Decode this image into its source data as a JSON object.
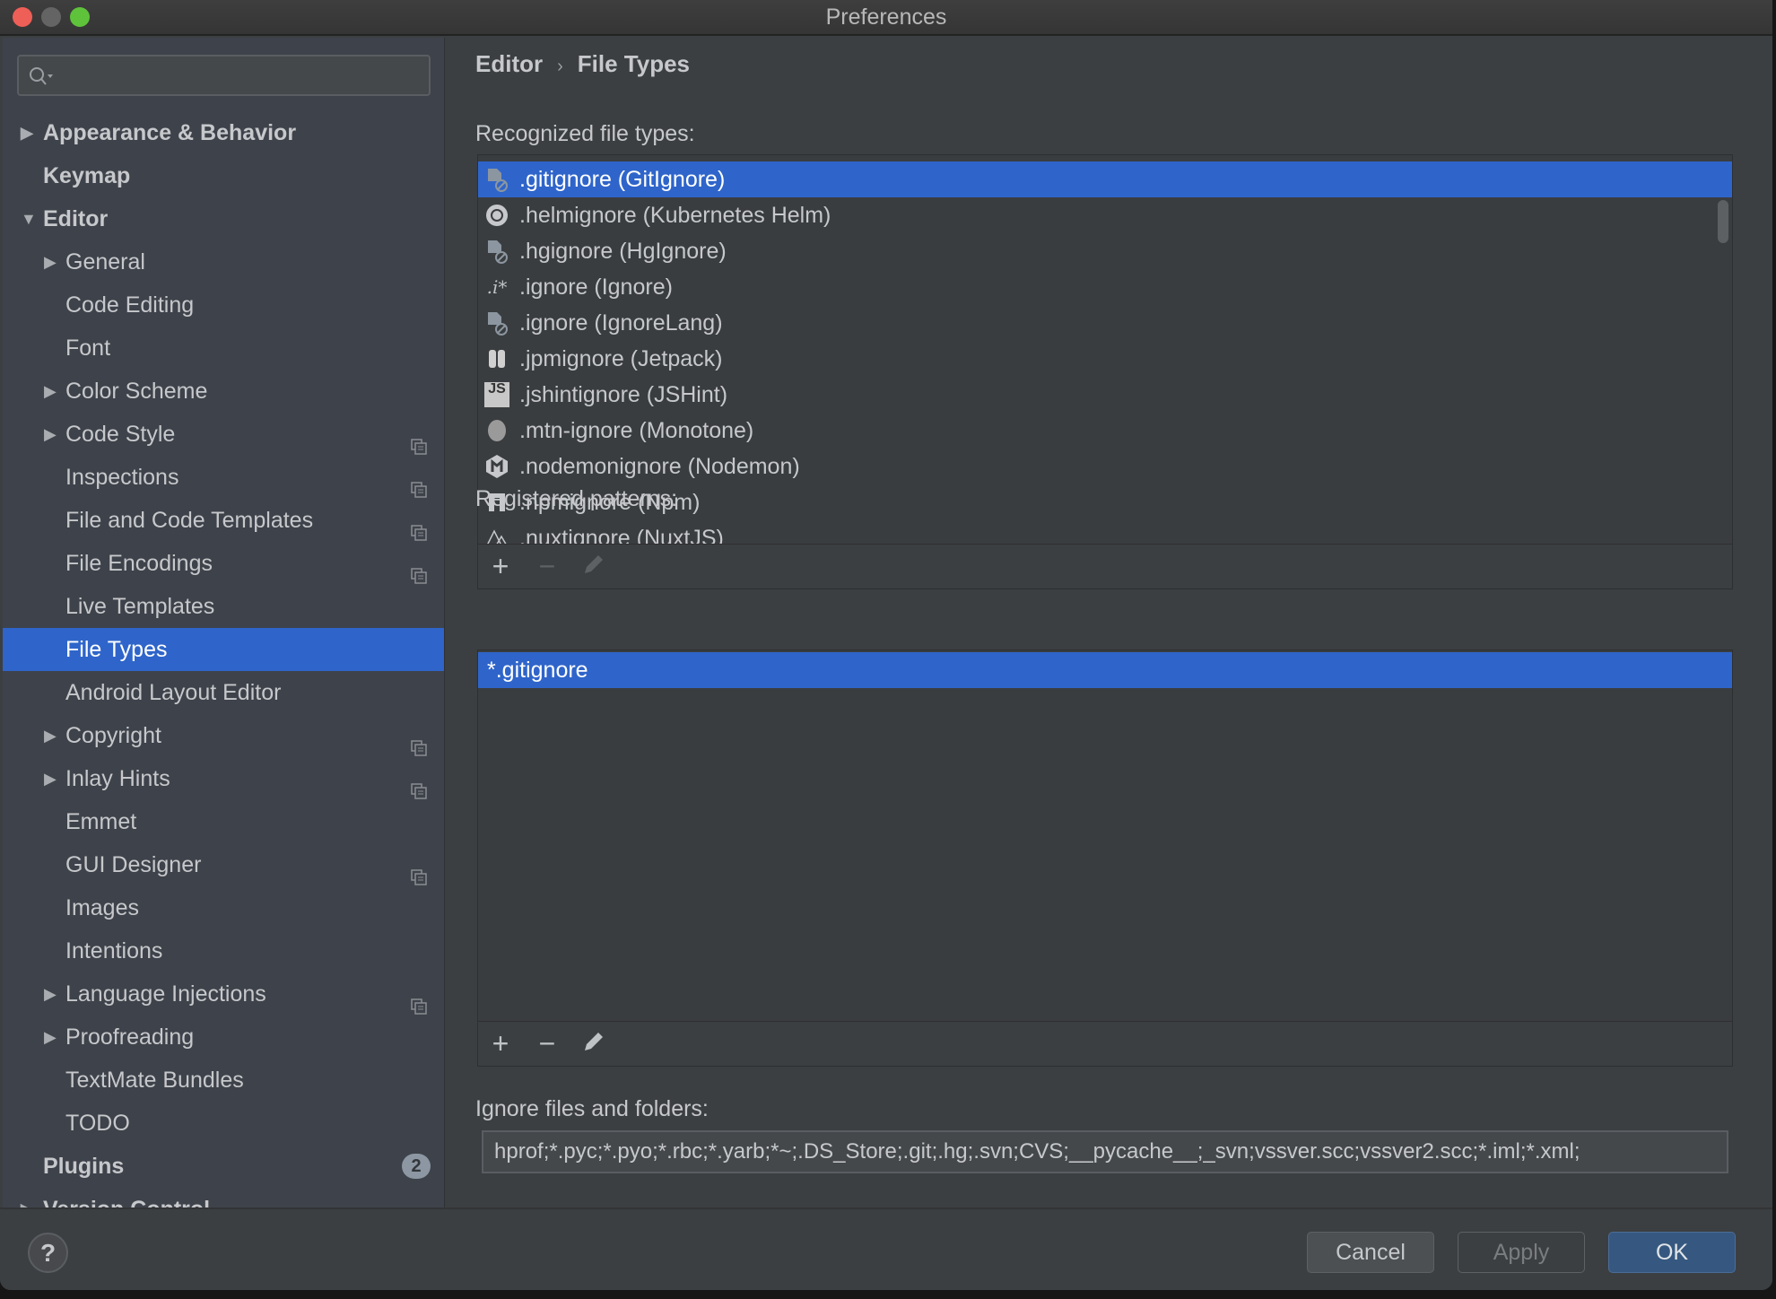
{
  "window": {
    "title": "Preferences",
    "traffic_lights": {
      "close": "#ee5f57",
      "minimize": "#646464",
      "zoom": "#5fc23b"
    }
  },
  "search": {
    "placeholder": "",
    "value": ""
  },
  "sidebar": {
    "items": [
      {
        "label": "Appearance & Behavior",
        "level": 0,
        "arrow": "right",
        "bold": true
      },
      {
        "label": "Keymap",
        "level": 0,
        "bold": true
      },
      {
        "label": "Editor",
        "level": 0,
        "arrow": "down",
        "bold": true
      },
      {
        "label": "General",
        "level": 1,
        "arrow": "right"
      },
      {
        "label": "Code Editing",
        "level": 1
      },
      {
        "label": "Font",
        "level": 1
      },
      {
        "label": "Color Scheme",
        "level": 1,
        "arrow": "right"
      },
      {
        "label": "Code Style",
        "level": 1,
        "arrow": "right",
        "project_icon": true
      },
      {
        "label": "Inspections",
        "level": 1,
        "project_icon": true
      },
      {
        "label": "File and Code Templates",
        "level": 1,
        "project_icon": true
      },
      {
        "label": "File Encodings",
        "level": 1,
        "project_icon": true
      },
      {
        "label": "Live Templates",
        "level": 1
      },
      {
        "label": "File Types",
        "level": 1,
        "selected": true
      },
      {
        "label": "Android Layout Editor",
        "level": 1
      },
      {
        "label": "Copyright",
        "level": 1,
        "arrow": "right",
        "project_icon": true
      },
      {
        "label": "Inlay Hints",
        "level": 1,
        "arrow": "right",
        "project_icon": true
      },
      {
        "label": "Emmet",
        "level": 1
      },
      {
        "label": "GUI Designer",
        "level": 1,
        "project_icon": true
      },
      {
        "label": "Images",
        "level": 1
      },
      {
        "label": "Intentions",
        "level": 1
      },
      {
        "label": "Language Injections",
        "level": 1,
        "arrow": "right",
        "project_icon": true
      },
      {
        "label": "Proofreading",
        "level": 1,
        "arrow": "right"
      },
      {
        "label": "TextMate Bundles",
        "level": 1
      },
      {
        "label": "TODO",
        "level": 1
      },
      {
        "label": "Plugins",
        "level": 0,
        "bold": true,
        "badge": "2"
      },
      {
        "label": "Version Control",
        "level": 0,
        "arrow": "right",
        "bold": true,
        "project_icon": true
      }
    ]
  },
  "breadcrumb": {
    "parent": "Editor",
    "separator": "›",
    "current": "File Types"
  },
  "recognized": {
    "label": "Recognized file types:",
    "items": [
      {
        "label": ".gitignore (GitIgnore)",
        "icon": "ignore-file-icon",
        "selected": true
      },
      {
        "label": ".helmignore (Kubernetes Helm)",
        "icon": "helm-icon"
      },
      {
        "label": ".hgignore (HgIgnore)",
        "icon": "ignore-file-icon"
      },
      {
        "label": ".ignore (Ignore)",
        "icon": "ignore-glyph-icon",
        "glyph": ".i*"
      },
      {
        "label": ".ignore (IgnoreLang)",
        "icon": "ignore-file-icon"
      },
      {
        "label": ".jpmignore (Jetpack)",
        "icon": "jetpack-icon"
      },
      {
        "label": ".jshintignore (JSHint)",
        "icon": "jshint-icon",
        "glyph": "JS"
      },
      {
        "label": ".mtn-ignore (Monotone)",
        "icon": "monotone-icon"
      },
      {
        "label": ".nodemonignore (Nodemon)",
        "icon": "nodemon-icon"
      },
      {
        "label": ".npmignore (Npm)",
        "icon": "npm-icon"
      },
      {
        "label": ".nuxtignore (NuxtJS)",
        "icon": "nuxt-icon"
      }
    ]
  },
  "patterns": {
    "label": "Registered patterns:",
    "items": [
      {
        "label": "*.gitignore",
        "selected": true
      }
    ]
  },
  "toolbar": {
    "add": "+",
    "remove": "−"
  },
  "ignore": {
    "label": "Ignore files and folders:",
    "value": "hprof;*.pyc;*.pyo;*.rbc;*.yarb;*~;.DS_Store;.git;.hg;.svn;CVS;__pycache__;_svn;vssver.scc;vssver2.scc;*.iml;*.xml;"
  },
  "buttons": {
    "help": "?",
    "cancel": "Cancel",
    "apply": "Apply",
    "ok": "OK"
  },
  "colors": {
    "accent": "#2f65ca",
    "ok_button": "#365880"
  }
}
